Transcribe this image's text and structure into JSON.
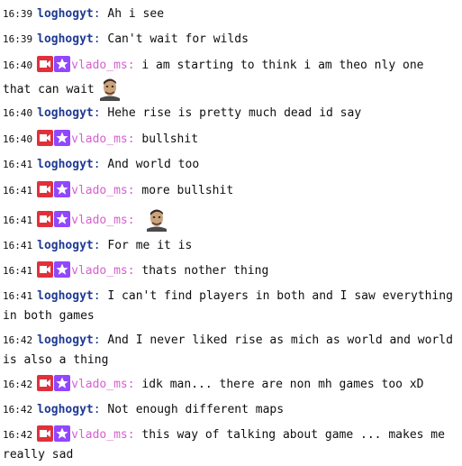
{
  "colors": {
    "loghogyt": "#1f3a93",
    "vlado_ms": "#d65fd0",
    "badge_red": "#e0313a",
    "badge_purple": "#9146ff"
  },
  "messages": [
    {
      "time": "16:39",
      "user": "loghogyt",
      "text": "Ah i see"
    },
    {
      "time": "16:39",
      "user": "loghogyt",
      "text": "Can't wait for wilds"
    },
    {
      "time": "16:40",
      "user": "vlado_ms",
      "badges": [
        "camera-badge",
        "star-badge"
      ],
      "text": "i am starting to think i am theo nly one that can wait",
      "emote": "face-emote"
    },
    {
      "time": "16:40",
      "user": "loghogyt",
      "text": "Hehe rise is pretty much dead id say"
    },
    {
      "time": "16:40",
      "user": "vlado_ms",
      "badges": [
        "camera-badge",
        "star-badge"
      ],
      "text": "bullshit"
    },
    {
      "time": "16:41",
      "user": "loghogyt",
      "text": "And world too"
    },
    {
      "time": "16:41",
      "user": "vlado_ms",
      "badges": [
        "camera-badge",
        "star-badge"
      ],
      "text": "more bullshit"
    },
    {
      "time": "16:41",
      "user": "vlado_ms",
      "badges": [
        "camera-badge",
        "star-badge"
      ],
      "text": "",
      "emote": "face-emote"
    },
    {
      "time": "16:41",
      "user": "loghogyt",
      "text": "For me it is"
    },
    {
      "time": "16:41",
      "user": "vlado_ms",
      "badges": [
        "camera-badge",
        "star-badge"
      ],
      "text": "thats nother thing"
    },
    {
      "time": "16:41",
      "user": "loghogyt",
      "text": "I can't find players in both and I saw everything in both games"
    },
    {
      "time": "16:42",
      "user": "loghogyt",
      "text": "And I never liked rise as mich as world and world is also a thing"
    },
    {
      "time": "16:42",
      "user": "vlado_ms",
      "badges": [
        "camera-badge",
        "star-badge"
      ],
      "text": "idk man... there are non mh games too xD"
    },
    {
      "time": "16:42",
      "user": "loghogyt",
      "text": "Not enough different maps"
    },
    {
      "time": "16:42",
      "user": "vlado_ms",
      "badges": [
        "camera-badge",
        "star-badge"
      ],
      "text": "this way of talking about game ... makes me really sad"
    }
  ]
}
